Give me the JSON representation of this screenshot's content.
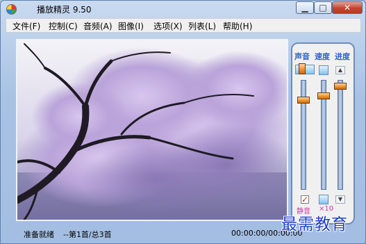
{
  "window": {
    "title": "播放精灵 9.50"
  },
  "menu": {
    "items": [
      {
        "label": "文件(F)"
      },
      {
        "label": "控制(C)"
      },
      {
        "label": "音频(A)"
      },
      {
        "label": "图像(I)"
      },
      {
        "label": "选项(X)"
      },
      {
        "label": "列表(L)"
      },
      {
        "label": "帮助(H)"
      }
    ]
  },
  "viewer": {
    "image": "cherry-blossom-tree-photo"
  },
  "controls": {
    "volume_label": "声音",
    "speed_label": "速度",
    "progress_label": "进度",
    "mute_label": "静音",
    "mute_checked": true,
    "speed_multiplier": "×10",
    "volume_level": 0.85,
    "speed_level": 0.85,
    "progress_level": 0.95
  },
  "status": {
    "state": "准备就绪",
    "track": "--第1首/总3首",
    "time": "00:00:00/00:00:00"
  },
  "watermark": "最需教育",
  "colors": {
    "accent": "#2f62c9",
    "mute": "#d43ca0",
    "watermark": "#1e41c8"
  }
}
